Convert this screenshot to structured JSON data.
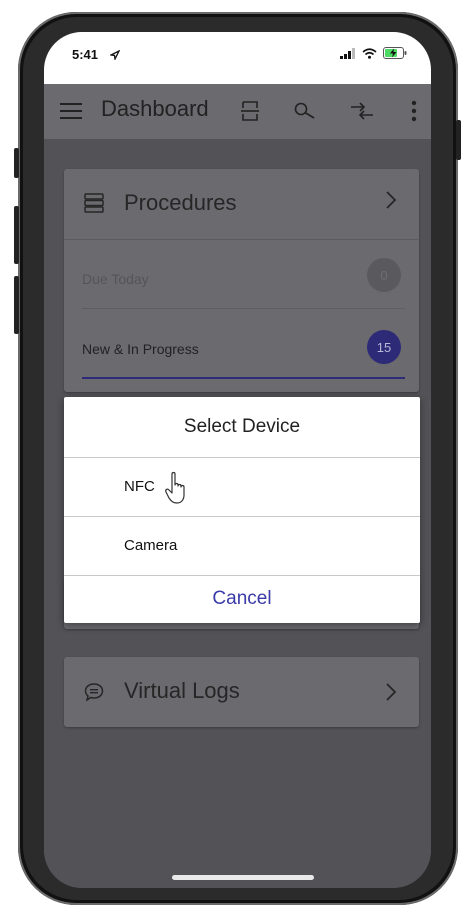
{
  "status_bar": {
    "time": "5:41"
  },
  "app_bar": {
    "title": "Dashboard",
    "icons": [
      "menu-icon",
      "scan-icon",
      "search-icon",
      "sync-icon",
      "more-icon"
    ]
  },
  "procedures_card": {
    "title": "Procedures",
    "rows": [
      {
        "label": "Due Today",
        "count": "0"
      },
      {
        "label": "New & In Progress",
        "count": "15"
      }
    ]
  },
  "virtual_logs_card": {
    "title": "Virtual Logs"
  },
  "dialog": {
    "title": "Select Device",
    "options": [
      "NFC",
      "Camera"
    ],
    "cancel_label": "Cancel"
  },
  "colors": {
    "accent": "#2d2a78",
    "cancel_text": "#3a3aa8"
  }
}
